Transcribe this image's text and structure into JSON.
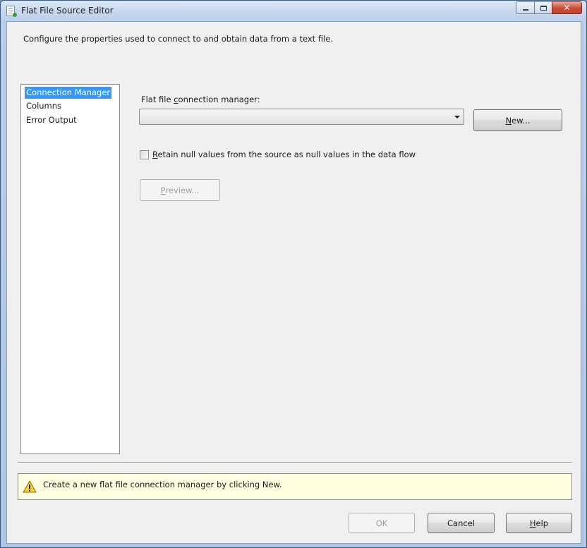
{
  "window": {
    "title": "Flat File Source Editor"
  },
  "description": "Configure the properties used to connect to and obtain data from a text file.",
  "nav": {
    "items": [
      {
        "label": "Connection Manager",
        "selected": true
      },
      {
        "label": "Columns",
        "selected": false
      },
      {
        "label": "Error Output",
        "selected": false
      }
    ]
  },
  "connection": {
    "label_before": "Flat file ",
    "label_mnemonic": "c",
    "label_after": "onnection manager:",
    "selected_value": "",
    "new_button_mnemonic": "N",
    "new_button_rest": "ew..."
  },
  "retain_nulls": {
    "checked": false,
    "label_mnemonic": "R",
    "label_rest": "etain null values from the source as null values in the data flow"
  },
  "preview_button": {
    "mnemonic": "P",
    "rest": "review...",
    "enabled": false
  },
  "message": {
    "text": "Create a new flat file connection manager by clicking New.",
    "icon": "warning-icon"
  },
  "buttons": {
    "ok": "OK",
    "cancel": "Cancel",
    "help_mnemonic": "H",
    "help_rest": "elp"
  },
  "colors": {
    "selection": "#3399ff",
    "message_background": "#ffffe1",
    "close_button": "#c74a38"
  }
}
